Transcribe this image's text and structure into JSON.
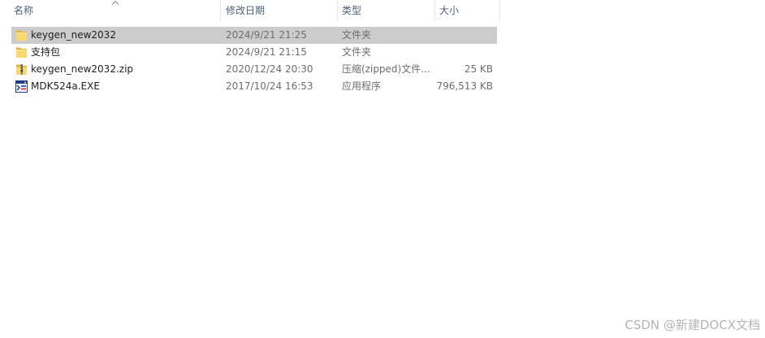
{
  "header": {
    "columns": [
      {
        "label": "名称"
      },
      {
        "label": "修改日期"
      },
      {
        "label": "类型"
      },
      {
        "label": "大小"
      }
    ],
    "sort_icon": "chevron-up-icon"
  },
  "files": [
    {
      "icon": "folder-icon",
      "name": "keygen_new2032",
      "modified": "2024/9/21 21:25",
      "type": "文件夹",
      "selected": true
    },
    {
      "icon": "folder-icon",
      "name": "支持包",
      "modified": "2024/9/21 21:15",
      "type": "文件夹",
      "selected": false
    },
    {
      "icon": "zip-folder-icon",
      "name": "keygen_new2032.zip",
      "modified": "2020/12/24 20:30",
      "type": "压缩(zipped)文件...",
      "size": "25 KB",
      "selected": false
    },
    {
      "icon": "exe-icon",
      "name": "MDK524a.EXE",
      "modified": "2017/10/24 16:53",
      "type": "应用程序",
      "size": "796,513 KB",
      "selected": false
    }
  ],
  "watermark": "CSDN @新建DOCX文档",
  "colors": {
    "selected_row": "#cccccc",
    "header_text": "#4c607a",
    "secondary_text": "#6d6d6d",
    "watermark": "#b4b4b4"
  }
}
